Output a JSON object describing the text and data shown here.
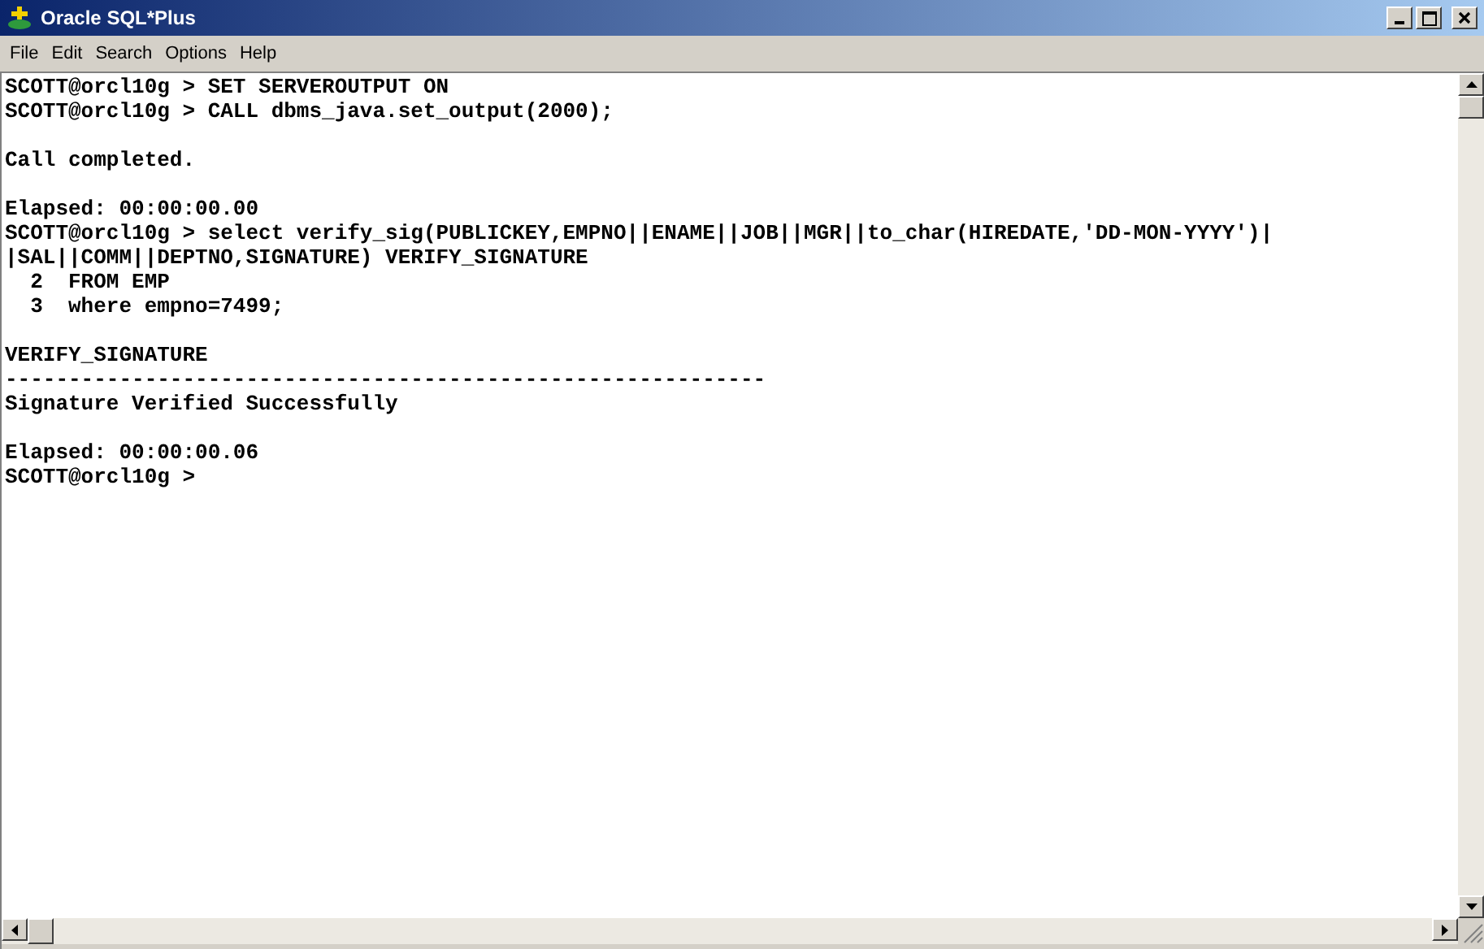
{
  "window": {
    "title": "Oracle SQL*Plus"
  },
  "menu": [
    "File",
    "Edit",
    "Search",
    "Options",
    "Help"
  ],
  "console": {
    "blocks": [
      [
        "SCOTT@orcl10g > SET SERVEROUTPUT ON",
        "SCOTT@orcl10g > CALL dbms_java.set_output(2000);"
      ],
      [
        "Call completed."
      ],
      [
        "Elapsed: 00:00:00.00",
        "SCOTT@orcl10g > select verify_sig(PUBLICKEY,EMPNO||ENAME||JOB||MGR||to_char(HIREDATE,'DD-MON-YYYY')|",
        "|SAL||COMM||DEPTNO,SIGNATURE) VERIFY_SIGNATURE",
        "  2  FROM EMP",
        "  3  where empno=7499;"
      ],
      [
        "VERIFY_SIGNATURE",
        "------------------------------------------------------------",
        "Signature Verified Successfully"
      ],
      [
        "Elapsed: 00:00:00.06",
        "SCOTT@orcl10g >"
      ]
    ]
  }
}
